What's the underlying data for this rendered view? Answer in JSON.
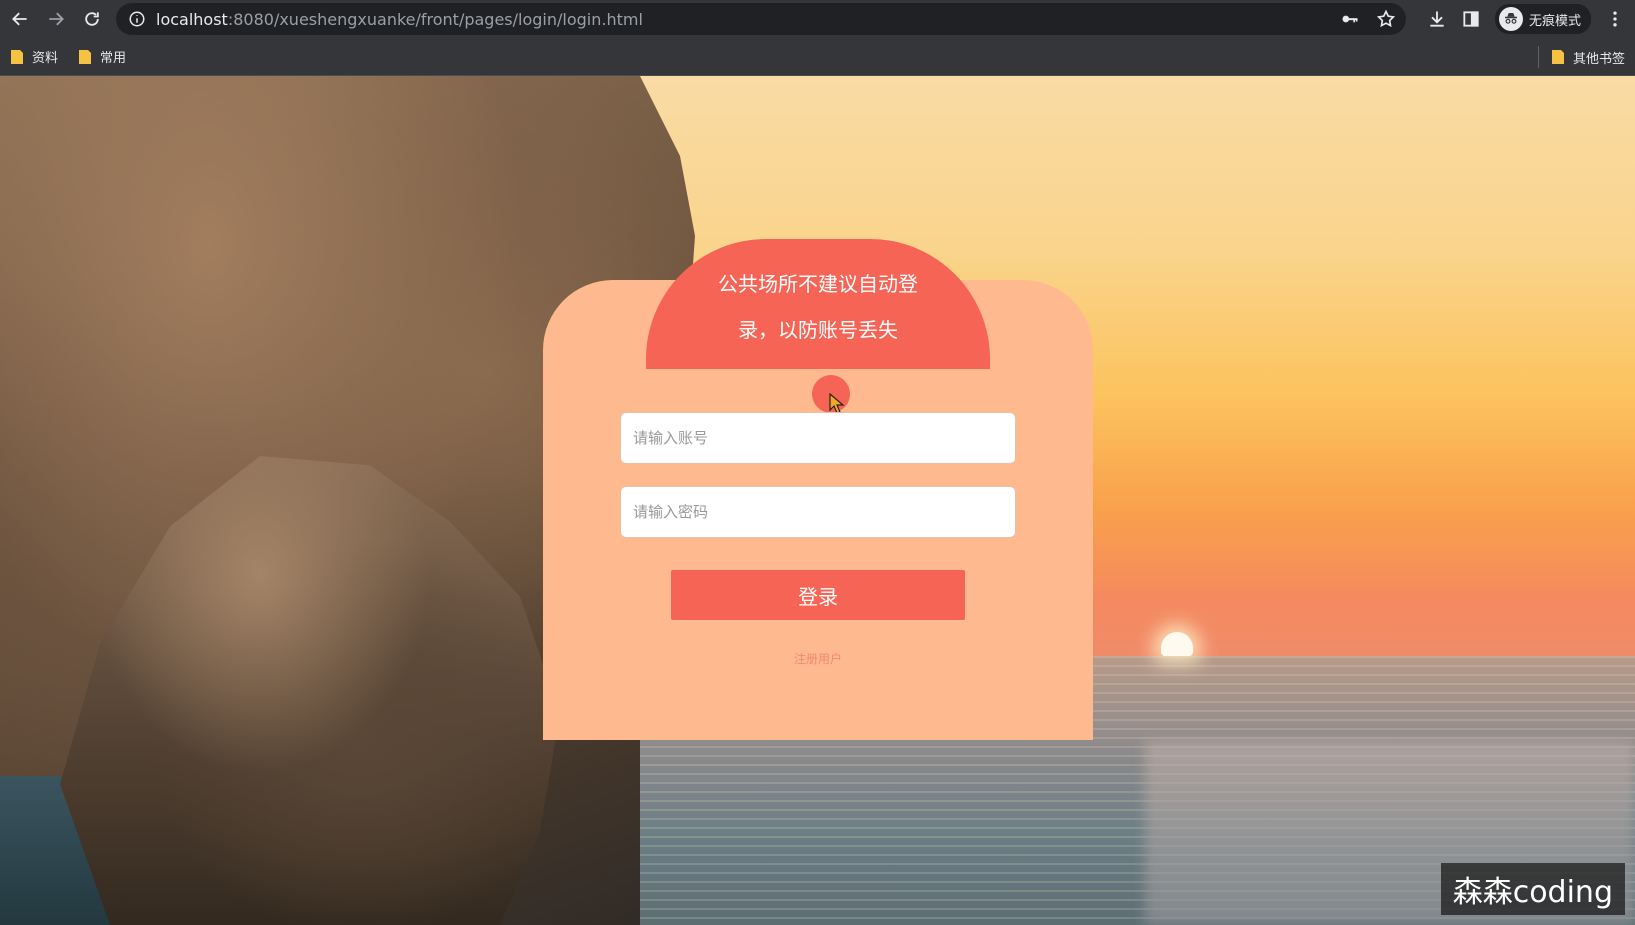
{
  "browser": {
    "url_host": "localhost",
    "url_rest": ":8080/xueshengxuanke/front/pages/login/login.html",
    "incognito_label": "无痕模式"
  },
  "bookmarks": {
    "items": [
      {
        "label": "资料"
      },
      {
        "label": "常用"
      }
    ],
    "other_label": "其他书签"
  },
  "login": {
    "tip_line1": "公共场所不建议自动登",
    "tip_line2": "录，以防账号丢失",
    "username_placeholder": "请输入账号",
    "password_placeholder": "请输入密码",
    "login_button": "登录",
    "register_link": "注册用户"
  },
  "watermark": "森森coding",
  "colors": {
    "primary": "#f66456",
    "card": "#ffb98e",
    "register_link": "#f08a70"
  }
}
